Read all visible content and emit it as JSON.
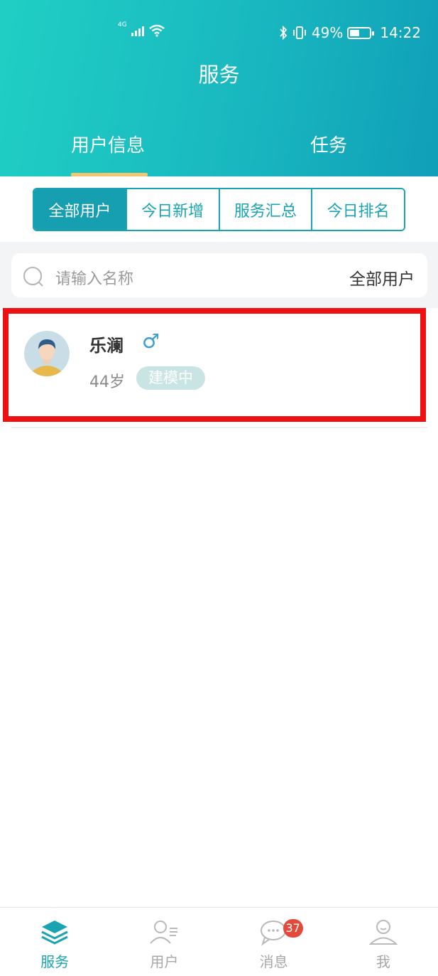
{
  "status_bar": {
    "network": "4G",
    "battery_text": "49%",
    "battery_level": 0.49,
    "time": "14:22"
  },
  "header": {
    "title": "服务",
    "tabs": [
      {
        "label": "用户信息",
        "active": true
      },
      {
        "label": "任务",
        "active": false
      }
    ]
  },
  "segments": [
    {
      "label": "全部用户",
      "active": true
    },
    {
      "label": "今日新增",
      "active": false
    },
    {
      "label": "服务汇总",
      "active": false
    },
    {
      "label": "今日排名",
      "active": false
    }
  ],
  "search": {
    "placeholder": "请输入名称",
    "filter_label": "全部用户"
  },
  "users": [
    {
      "name": "乐澜",
      "gender_symbol": "♂",
      "age": "44岁",
      "status": "建模中"
    }
  ],
  "bottom_nav": [
    {
      "label": "服务",
      "icon": "layers-icon",
      "active": true
    },
    {
      "label": "用户",
      "icon": "user-list-icon",
      "active": false
    },
    {
      "label": "消息",
      "icon": "chat-icon",
      "active": false,
      "badge": "37"
    },
    {
      "label": "我",
      "icon": "profile-icon",
      "active": false
    }
  ],
  "colors": {
    "accent": "#1aa3b0",
    "header_start": "#20cfc4",
    "header_end": "#109fb8",
    "tab_underline": "#f2c56f",
    "highlight_box": "#ee1111",
    "badge": "#e24a3c"
  }
}
